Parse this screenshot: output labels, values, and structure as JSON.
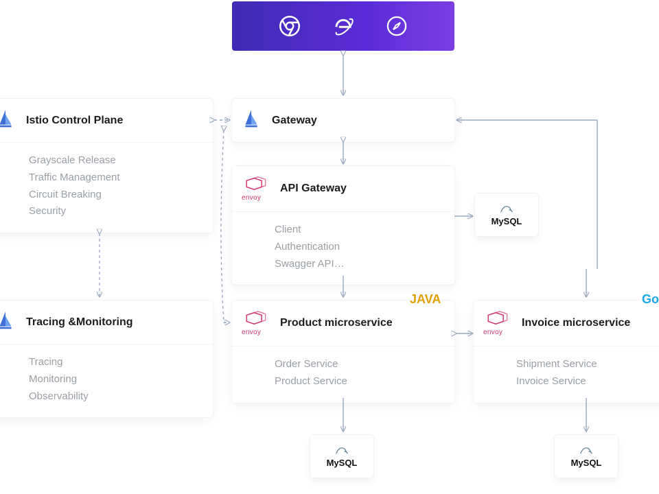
{
  "browsers": {
    "icons": [
      "chrome-icon",
      "ie-icon",
      "safari-icon"
    ]
  },
  "boxes": {
    "istio": {
      "title": "Istio Control Plane",
      "items": [
        "Grayscale Release",
        "Traffic Management",
        "Circuit Breaking",
        "Security"
      ]
    },
    "gateway": {
      "title": "Gateway"
    },
    "api": {
      "title": "API Gateway",
      "items": [
        "Client",
        "Authentication",
        "Swagger API…"
      ]
    },
    "tracing": {
      "title": "Tracing &Monitoring",
      "items": [
        "Tracing",
        "Monitoring",
        "Observability"
      ]
    },
    "product": {
      "title": "Product microservice",
      "items": [
        "Order Service",
        "Product Service"
      ]
    },
    "invoice": {
      "title": "Invoice microservice",
      "items": [
        "Shipment Service",
        "Invoice Service"
      ]
    }
  },
  "tags": {
    "java": "JAVA",
    "go": "Go"
  },
  "mysql": {
    "label": "MySQL"
  },
  "envoy": {
    "label": "envoy"
  }
}
